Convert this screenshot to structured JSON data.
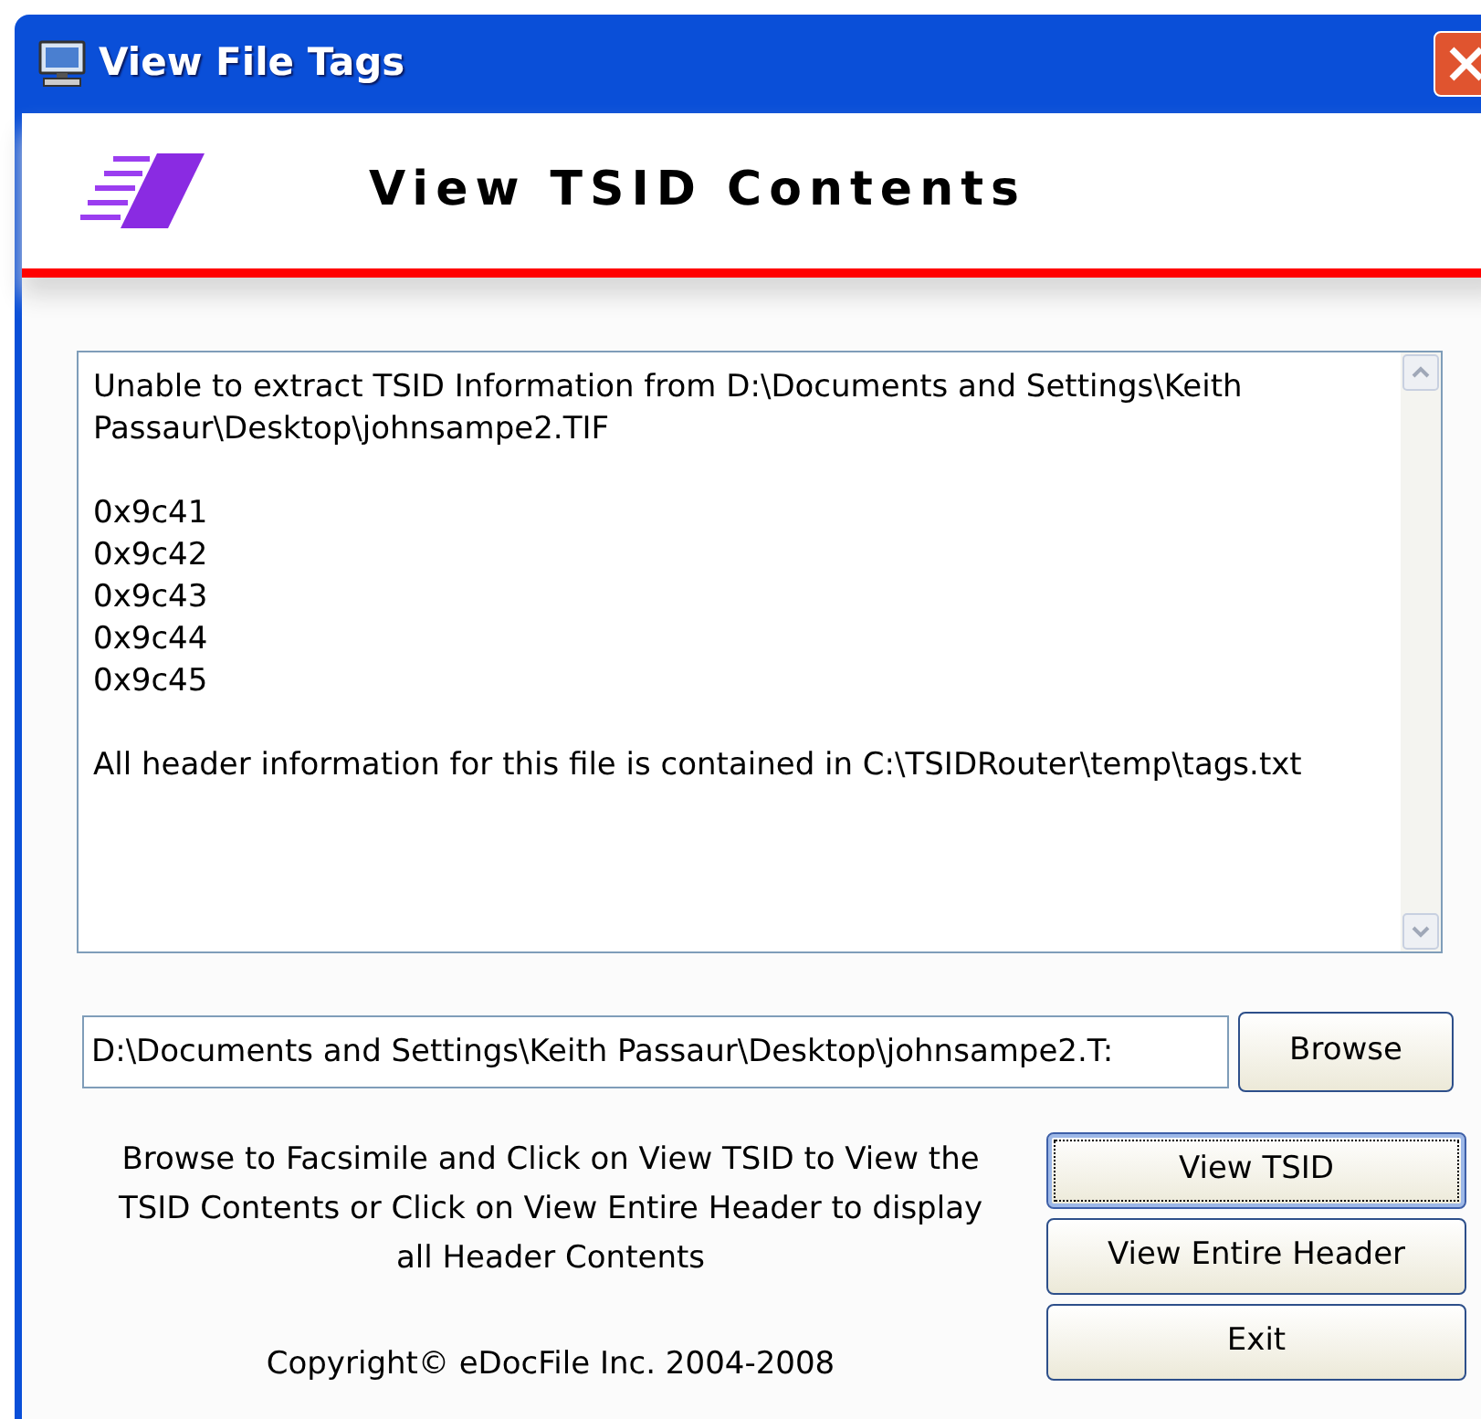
{
  "window": {
    "title": "View File Tags"
  },
  "banner": {
    "title": "View TSID Contents"
  },
  "output": {
    "paragraphs": [
      [
        "Unable to extract TSID Information from D:\\Documents and Settings\\Keith Passaur\\Desktop\\johnsampe2.TIF"
      ],
      [
        "0x9c41",
        "0x9c42",
        "0x9c43",
        "0x9c44",
        "0x9c45"
      ],
      [
        "All header information for this file is contained in C:\\TSIDRouter\\temp\\tags.txt"
      ]
    ]
  },
  "file_path": {
    "value": "D:\\Documents and Settings\\Keith Passaur\\Desktop\\johnsampe2.T:"
  },
  "browse_button": "Browse",
  "instructions": "Browse to Facsimile and Click on View TSID to View the TSID Contents or Click on View Entire Header to display all Header Contents",
  "copyright": "Copyright© eDocFile Inc. 2004-2008",
  "buttons": [
    {
      "label": "View TSID",
      "focused": true
    },
    {
      "label": "View Entire Header",
      "focused": false
    },
    {
      "label": "Exit",
      "focused": false
    }
  ]
}
